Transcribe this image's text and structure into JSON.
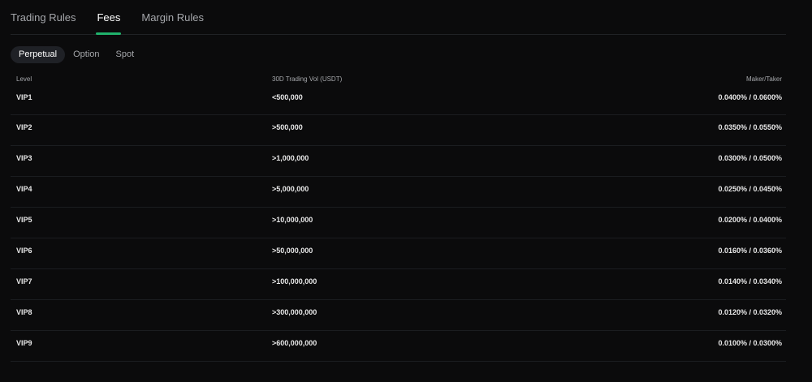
{
  "tabs": [
    {
      "label": "Trading Rules",
      "active": false
    },
    {
      "label": "Fees",
      "active": true
    },
    {
      "label": "Margin Rules",
      "active": false
    }
  ],
  "subtabs": [
    {
      "label": "Perpetual",
      "active": true
    },
    {
      "label": "Option",
      "active": false
    },
    {
      "label": "Spot",
      "active": false
    }
  ],
  "table": {
    "headers": {
      "level": "Level",
      "volume": "30D Trading Vol (USDT)",
      "fees": "Maker/Taker"
    },
    "rows": [
      {
        "level": "VIP1",
        "volume": "<500,000",
        "fees": "0.0400% / 0.0600%"
      },
      {
        "level": "VIP2",
        "volume": ">500,000",
        "fees": "0.0350% / 0.0550%"
      },
      {
        "level": "VIP3",
        "volume": ">1,000,000",
        "fees": "0.0300% / 0.0500%"
      },
      {
        "level": "VIP4",
        "volume": ">5,000,000",
        "fees": "0.0250% / 0.0450%"
      },
      {
        "level": "VIP5",
        "volume": ">10,000,000",
        "fees": "0.0200% / 0.0400%"
      },
      {
        "level": "VIP6",
        "volume": ">50,000,000",
        "fees": "0.0160% / 0.0360%"
      },
      {
        "level": "VIP7",
        "volume": ">100,000,000",
        "fees": "0.0140% / 0.0340%"
      },
      {
        "level": "VIP8",
        "volume": ">300,000,000",
        "fees": "0.0120% / 0.0320%"
      },
      {
        "level": "VIP9",
        "volume": ">600,000,000",
        "fees": "0.0100% / 0.0300%"
      }
    ]
  },
  "colors": {
    "background": "#0b0b0c",
    "accent": "#20b26c",
    "pill": "#1f2126"
  }
}
